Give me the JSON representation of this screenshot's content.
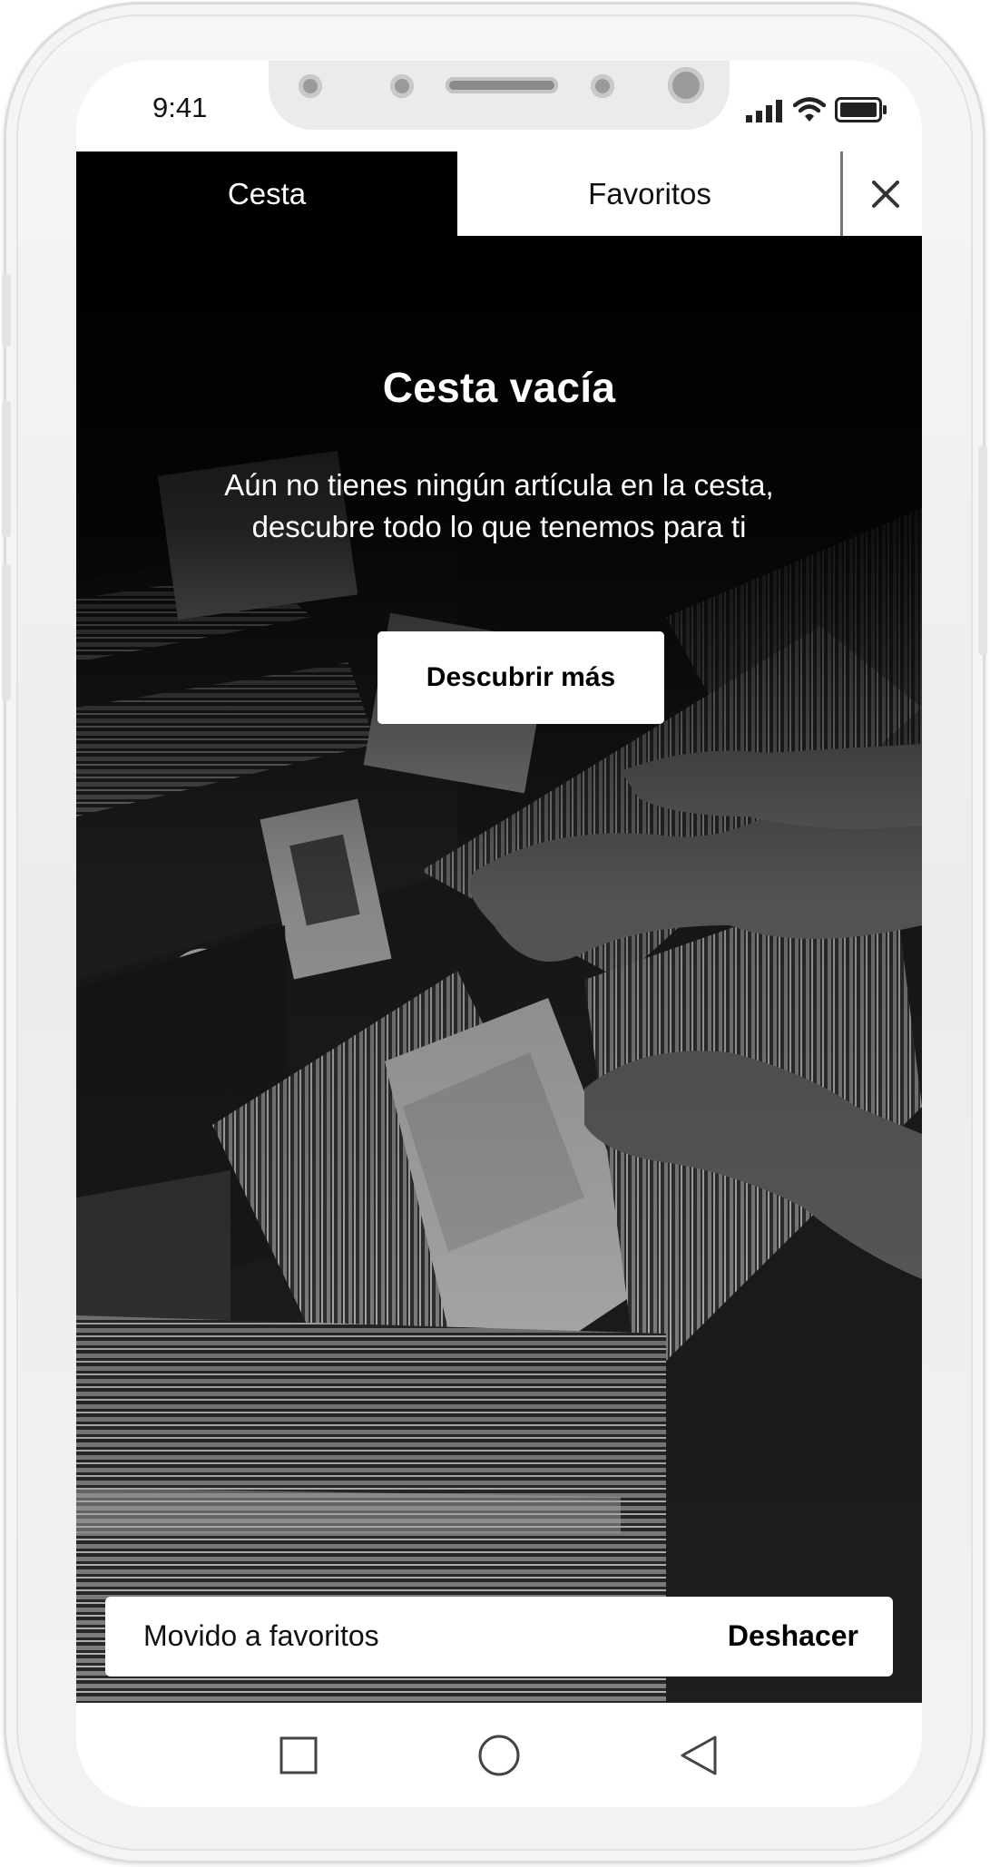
{
  "status_bar": {
    "time": "9:41"
  },
  "tabs": [
    {
      "label": "Cesta",
      "active": true
    },
    {
      "label": "Favoritos",
      "active": false
    }
  ],
  "empty_state": {
    "title": "Cesta vacía",
    "message_line1": "Aún no tienes ningún artícula en la cesta,",
    "message_line2": "descubre todo lo que tenemos para ti",
    "button_label": "Descubrir más"
  },
  "snackbar": {
    "message": "Movido a favoritos",
    "action_label": "Deshacer"
  },
  "icons": {
    "close": "close-icon",
    "signal": "signal-icon",
    "wifi": "wifi-icon",
    "battery": "battery-icon",
    "nav_recents": "square-icon",
    "nav_home": "circle-icon",
    "nav_back": "triangle-back-icon"
  },
  "colors": {
    "active_tab_bg": "#000000",
    "inactive_tab_bg": "#ffffff",
    "text_on_dark": "#ffffff"
  }
}
